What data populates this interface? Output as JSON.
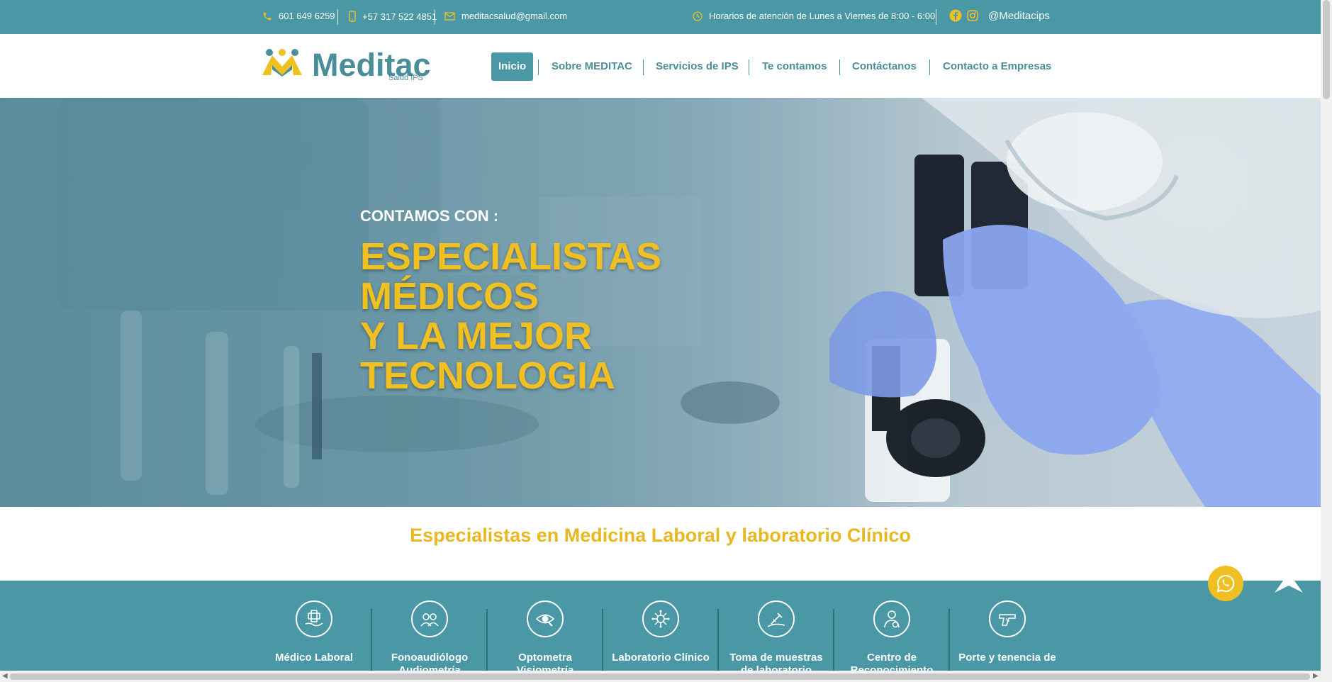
{
  "topbar": {
    "phone": "601 649 6259",
    "mobile": "+57 317 522 4851",
    "email": "meditacsalud@gmail.com",
    "hours": "Horarios de atención de Lunes a Viernes de 8:00 - 6:00",
    "handle": "@Meditacips"
  },
  "header": {
    "logo_text": "Meditac",
    "logo_sub": "Salud IPS",
    "nav": [
      "Inicio",
      "Sobre MEDITAC",
      "Servicios de IPS",
      "Te contamos",
      "Contáctanos",
      "Contacto a Empresas"
    ]
  },
  "hero": {
    "pre": "CONTAMOS CON :",
    "lines": [
      "ESPECIALISTAS",
      "MÉDICOS",
      "Y LA MEJOR",
      "TECNOLOGIA"
    ]
  },
  "tagline": "Especialistas en Medicina Laboral y laboratorio Clínico",
  "services": [
    {
      "label": "Médico Laboral"
    },
    {
      "label": "Fonoaudiólogo Audiometría"
    },
    {
      "label": "Optometra Visiometría"
    },
    {
      "label": "Laboratorio Clínico"
    },
    {
      "label": "Toma de muestras de laboratorio"
    },
    {
      "label": "Centro de Reconocimiento"
    },
    {
      "label": "Porte y tenencia de"
    }
  ],
  "colors": {
    "teal": "#4a97a5",
    "yellow": "#f0c023",
    "nav_text": "#4a8e99"
  },
  "icons": [
    "phone-icon",
    "mobile-icon",
    "mail-icon",
    "clock-icon",
    "facebook-icon",
    "instagram-icon",
    "whatsapp-icon",
    "arrow-up-icon"
  ]
}
